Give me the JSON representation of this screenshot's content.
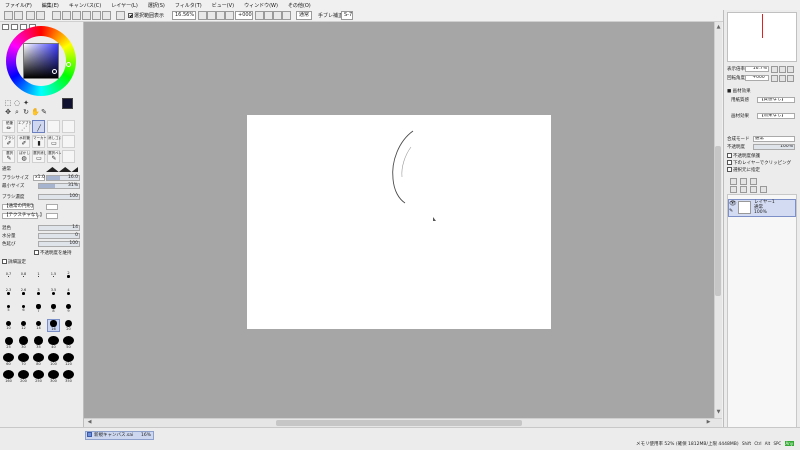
{
  "menu": [
    "ファイル(F)",
    "編集(E)",
    "キャンバス(C)",
    "レイヤー(L)",
    "選択(S)",
    "フィルタ(T)",
    "ビュー(V)",
    "ウィンドウ(W)",
    "その他(O)"
  ],
  "toolbar": {
    "selection_checkbox_label": "選択範囲表示",
    "selection_checked": true,
    "zoom_value": "16.56%",
    "rotation_value": "+000°",
    "blend_mode": "通常",
    "stabilizer_label": "手ブレ補正",
    "stabilizer_value": "S-7"
  },
  "color_panel": {
    "foreground_color": "#101030"
  },
  "brush_tools": [
    {
      "label": "鉛筆",
      "icon": "pencil-icon"
    },
    {
      "label": "エアブラシ",
      "icon": "airbrush-icon"
    },
    {
      "label": "",
      "icon": "pen-icon",
      "selected": true
    },
    {
      "label": "",
      "icon": ""
    },
    {
      "label": "",
      "icon": ""
    },
    {
      "label": "ブラシ",
      "icon": "brush-icon"
    },
    {
      "label": "水彩筆",
      "icon": "watercolor-icon"
    },
    {
      "label": "マーカー",
      "icon": "marker-icon"
    },
    {
      "label": "消しゴム",
      "icon": "eraser-icon"
    },
    {
      "label": "",
      "icon": ""
    },
    {
      "label": "選択",
      "icon": "select-pen-icon"
    },
    {
      "label": "ぼかし",
      "icon": "blur-icon"
    },
    {
      "label": "選択消し",
      "icon": "select-erase-icon"
    },
    {
      "label": "選択ペン",
      "icon": "select-pen-icon"
    },
    {
      "label": "",
      "icon": ""
    }
  ],
  "brush_props": {
    "mode": "通常",
    "brush_size_label": "ブラシサイズ",
    "brush_size_multiplier": "x1.0",
    "brush_size_value": "16.0",
    "min_size_label": "最小サイズ",
    "min_size_value": "31%",
    "density_label": "ブラシ濃度",
    "density_value": "100",
    "shape_label": "【通常の円形】",
    "texture_label": "【テクスチャなし】",
    "blend_label": "混色",
    "blend_value": "14",
    "water_label": "水分量",
    "water_value": "0",
    "persistence_label": "色延び",
    "persistence_value": "100",
    "keep_opacity_label": "不透明度を維持",
    "advanced_label": "詳細設定"
  },
  "size_grid": [
    "0.7",
    "0.8",
    "1",
    "1.5",
    "2",
    "2.3",
    "2.6",
    "3",
    "3.5",
    "4",
    "5",
    "6",
    "7",
    "8",
    "9",
    "10",
    "12",
    "14",
    "16",
    "20",
    "25",
    "30",
    "35",
    "40",
    "50",
    "60",
    "70",
    "80",
    "100",
    "120",
    "160",
    "200",
    "250",
    "300",
    "350"
  ],
  "right_panel": {
    "zoom_label": "表示倍率",
    "zoom_value": "16.7%",
    "angle_label": "回転角度",
    "angle_value": "+000°",
    "effect_header": "■ 画材効果",
    "paper_label": "用紙質感",
    "paper_value": "【質感なし】",
    "texture_label": "画材効果",
    "texture_value": "【効果なし】",
    "mode_label": "合成モード",
    "mode_value": "通常",
    "opacity_label": "不透明度",
    "opacity_value": "100%",
    "protect_opacity": "不透明度保護",
    "clip_below": "下のレイヤーでクリッピング",
    "select_source": "選択元に指定"
  },
  "layer": {
    "name": "レイヤー1",
    "mode": "通常",
    "opacity": "100%"
  },
  "document_tab": {
    "name": "新規キャンバス",
    "ext": ".sai",
    "zoom": "16%"
  },
  "status": {
    "memory": "メモリ使用率 52% (確保 1812MB/上限 4448MB)",
    "indicators": [
      "Shift",
      "Ctrl",
      "Alt",
      "SPC",
      "Any"
    ]
  }
}
